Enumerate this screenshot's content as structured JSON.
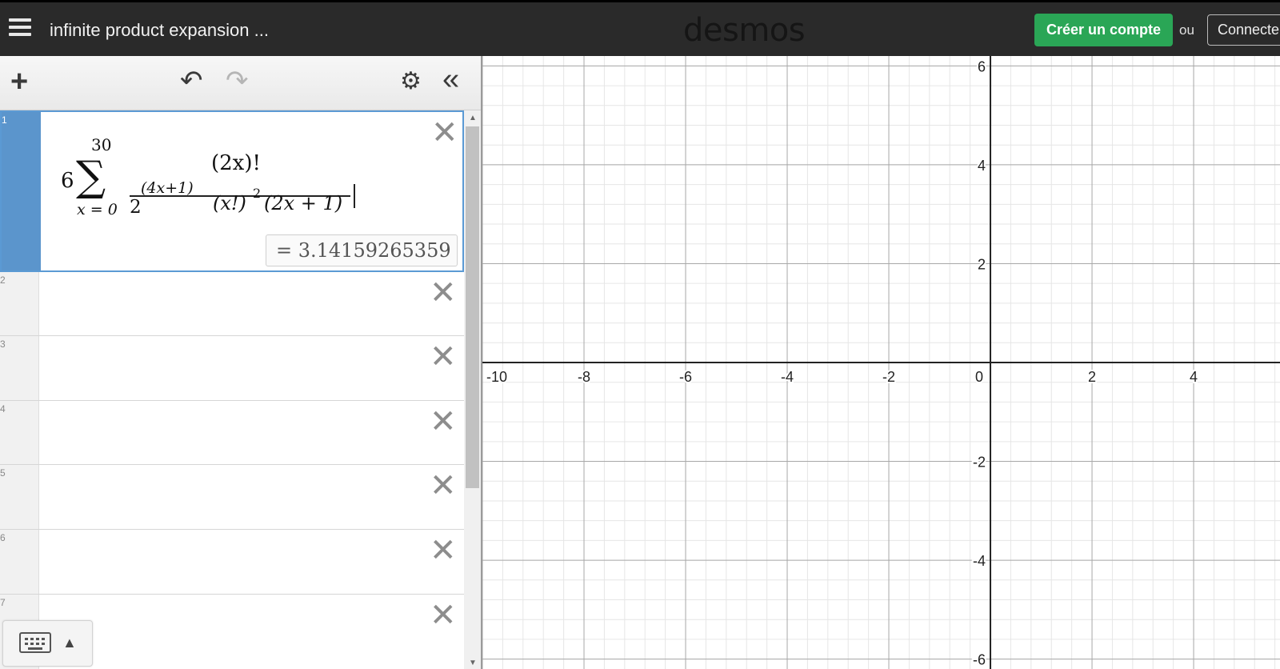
{
  "header": {
    "title": "infinite product expansion ...",
    "logo": "desmos",
    "create_account": "Créer un compte",
    "or": "ou",
    "login": "Connecter"
  },
  "toolbar": {
    "add_icon": "plus-icon",
    "undo_icon": "undo-icon",
    "redo_icon": "redo-icon",
    "settings_icon": "gear-icon",
    "collapse_icon": "double-chevron-left-icon"
  },
  "expressions": [
    {
      "number": "1",
      "latex": "6\\sum_{x=0}^{30}\\frac{(2x)!}{2^{(4x+1)}(x!)^2(2x+1)}",
      "math": {
        "coef": "6",
        "sum_upper": "30",
        "sum_symbol": "∑",
        "sum_lower": "x = 0",
        "numerator": "(2x)!",
        "den_base": "2",
        "den_exp": "(4x+1)",
        "den_fact": "(x!)",
        "den_fact_exp": "2",
        "den_tail": "(2x + 1)"
      },
      "result": "=  3.14159265359"
    },
    {
      "number": "2"
    },
    {
      "number": "3"
    },
    {
      "number": "4"
    },
    {
      "number": "5"
    },
    {
      "number": "6"
    },
    {
      "number": "7"
    }
  ],
  "keypad": {
    "icon": "keyboard-icon",
    "arrow": "▲"
  },
  "graph": {
    "x_ticks": [
      "-10",
      "-8",
      "-6",
      "-4",
      "-2",
      "0",
      "2",
      "4"
    ],
    "y_ticks": [
      "6",
      "4",
      "2",
      "-2",
      "-4",
      "-6"
    ],
    "xlim": [
      -10,
      5.7
    ],
    "ylim": [
      -6.2,
      6.2
    ],
    "grid": true
  }
}
